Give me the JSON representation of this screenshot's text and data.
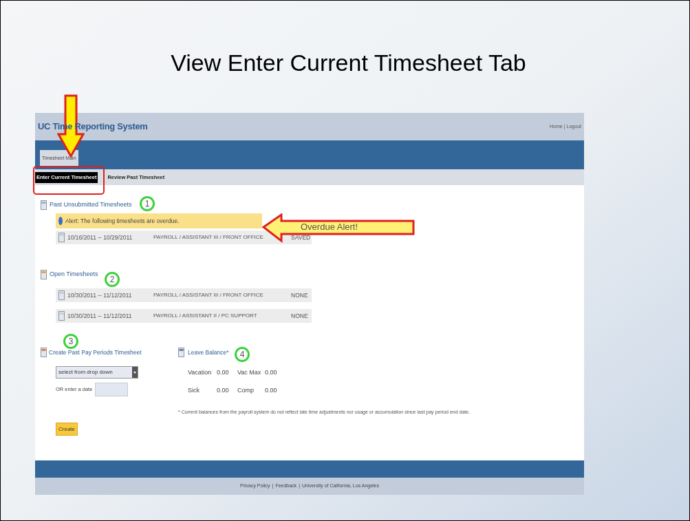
{
  "slide": {
    "title": "View Enter Current Timesheet Tab"
  },
  "app": {
    "title": "UC Time Reporting System",
    "top_links": [
      "Home",
      "Logout"
    ],
    "link_separator": "|",
    "menu_button": "Timesheet Main",
    "tabs": [
      {
        "label": "Enter Current Timesheet",
        "selected": true
      },
      {
        "label": "Review Past Timesheet",
        "selected": false
      }
    ],
    "past_unsubmitted": {
      "heading": "Past Unsubmitted Timesheets",
      "alert": "Alert: The following timesheets are overdue.",
      "rows": [
        {
          "period": "10/16/2011 -- 10/29/2011",
          "job": "PAYROLL / ASSISTANT III / FRONT OFFICE",
          "status": "SAVED"
        }
      ]
    },
    "open_timesheets": {
      "heading": "Open Timesheets",
      "rows": [
        {
          "period": "10/30/2011 -- 11/12/2011",
          "job": "PAYROLL / ASSISTANT III / FRONT OFFICE",
          "status": "NONE"
        },
        {
          "period": "10/30/2011 -- 11/12/2011",
          "job": "PAYROLL / ASSISTANT II / PC SUPPORT",
          "status": "NONE"
        }
      ]
    },
    "create_past": {
      "heading": "Create Past Pay Periods Timesheet",
      "select_value": "select from drop down",
      "date_label": "OR enter a date",
      "button": "Create"
    },
    "leave_balance": {
      "heading": "Leave Balance*",
      "rows": [
        [
          "Vacation",
          "0.00",
          "Vac Max",
          "0.00"
        ],
        [
          "Sick",
          "0.00",
          "Comp",
          "0.00"
        ]
      ],
      "note": "* Current balances from the payroll system do not reflect late time adjustments nor usage or accumulation since last pay period end date."
    },
    "footer_links": [
      "Privacy Policy",
      "Feedback",
      "University of California, Los Angeles"
    ]
  },
  "annotations": {
    "numbers": [
      "1",
      "2",
      "3",
      "4"
    ],
    "callout": "Overdue Alert!"
  }
}
